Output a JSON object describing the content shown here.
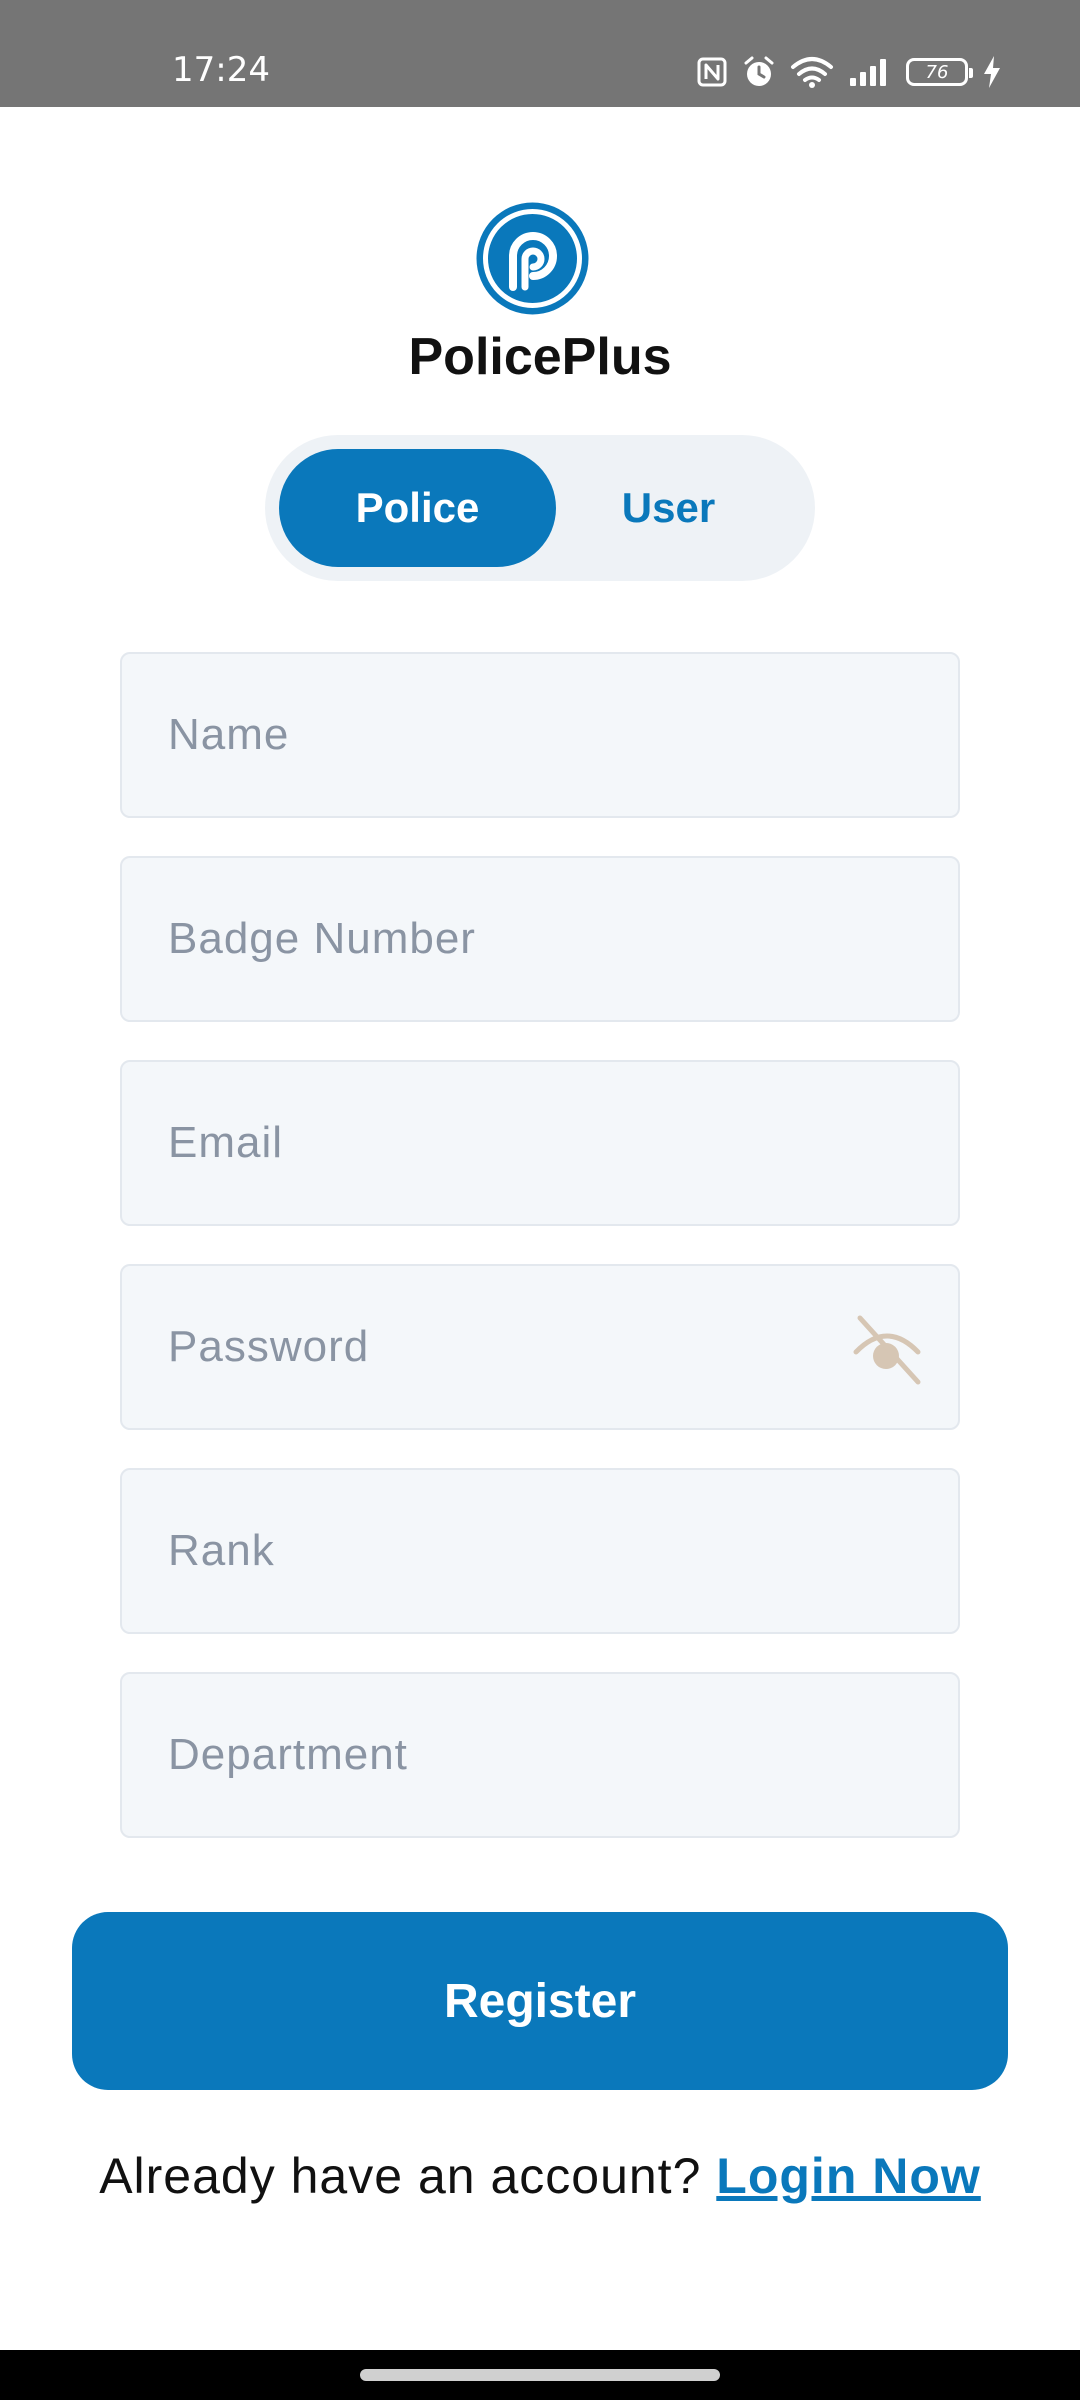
{
  "status_bar": {
    "time": "17:24",
    "battery_level": "76",
    "icons": [
      "nfc-icon",
      "alarm-icon",
      "wifi-icon",
      "signal-icon",
      "battery-icon",
      "charging-icon"
    ]
  },
  "app": {
    "title": "PolicePlus",
    "logo_icon": "policeplus-logo-icon"
  },
  "toggle": {
    "active": "Police",
    "options": [
      {
        "label": "Police"
      },
      {
        "label": "User"
      }
    ]
  },
  "form": {
    "fields": [
      {
        "placeholder": "Name",
        "value": ""
      },
      {
        "placeholder": "Badge Number",
        "value": ""
      },
      {
        "placeholder": "Email",
        "value": ""
      },
      {
        "placeholder": "Password",
        "value": "",
        "icon": "eye-off-icon"
      },
      {
        "placeholder": "Rank",
        "value": ""
      },
      {
        "placeholder": "Department",
        "value": ""
      }
    ],
    "submit_label": "Register"
  },
  "footer": {
    "prompt": "Already have an account?",
    "link_label": "Login Now"
  },
  "colors": {
    "primary": "#0a78bb",
    "field_bg": "#f4f7fa",
    "field_border": "#e3e8ee",
    "placeholder": "#8a94a3",
    "toggle_bg": "#eef2f6",
    "eye_icon": "#d6c6b4",
    "status_bar": "#757575"
  }
}
